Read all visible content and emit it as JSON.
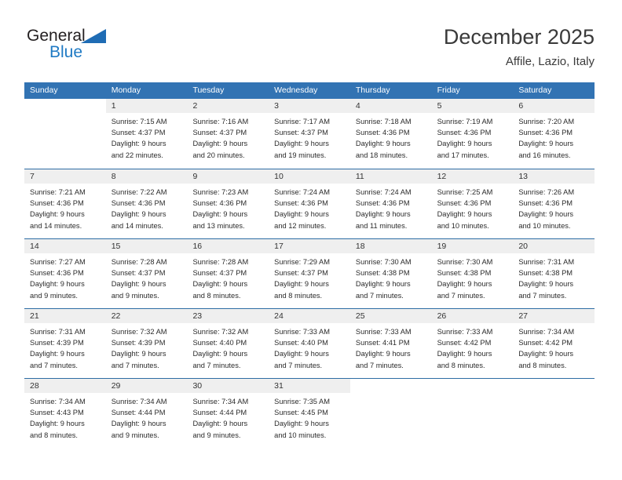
{
  "brand": {
    "name_part1": "General",
    "name_part2": "Blue",
    "triangle_color": "#1f6cb4",
    "blue_color": "#1f7ac4"
  },
  "header": {
    "title": "December 2025",
    "subtitle": "Affile, Lazio, Italy"
  },
  "theme": {
    "header_bg": "#3273b3",
    "row_rule": "#2e6da4",
    "num_band_bg": "#efefef"
  },
  "weekdays": [
    "Sunday",
    "Monday",
    "Tuesday",
    "Wednesday",
    "Thursday",
    "Friday",
    "Saturday"
  ],
  "weeks": [
    [
      {
        "day": "",
        "sunrise": "",
        "sunset": "",
        "daylight1": "",
        "daylight2": ""
      },
      {
        "day": "1",
        "sunrise": "Sunrise: 7:15 AM",
        "sunset": "Sunset: 4:37 PM",
        "daylight1": "Daylight: 9 hours",
        "daylight2": "and 22 minutes."
      },
      {
        "day": "2",
        "sunrise": "Sunrise: 7:16 AM",
        "sunset": "Sunset: 4:37 PM",
        "daylight1": "Daylight: 9 hours",
        "daylight2": "and 20 minutes."
      },
      {
        "day": "3",
        "sunrise": "Sunrise: 7:17 AM",
        "sunset": "Sunset: 4:37 PM",
        "daylight1": "Daylight: 9 hours",
        "daylight2": "and 19 minutes."
      },
      {
        "day": "4",
        "sunrise": "Sunrise: 7:18 AM",
        "sunset": "Sunset: 4:36 PM",
        "daylight1": "Daylight: 9 hours",
        "daylight2": "and 18 minutes."
      },
      {
        "day": "5",
        "sunrise": "Sunrise: 7:19 AM",
        "sunset": "Sunset: 4:36 PM",
        "daylight1": "Daylight: 9 hours",
        "daylight2": "and 17 minutes."
      },
      {
        "day": "6",
        "sunrise": "Sunrise: 7:20 AM",
        "sunset": "Sunset: 4:36 PM",
        "daylight1": "Daylight: 9 hours",
        "daylight2": "and 16 minutes."
      }
    ],
    [
      {
        "day": "7",
        "sunrise": "Sunrise: 7:21 AM",
        "sunset": "Sunset: 4:36 PM",
        "daylight1": "Daylight: 9 hours",
        "daylight2": "and 14 minutes."
      },
      {
        "day": "8",
        "sunrise": "Sunrise: 7:22 AM",
        "sunset": "Sunset: 4:36 PM",
        "daylight1": "Daylight: 9 hours",
        "daylight2": "and 14 minutes."
      },
      {
        "day": "9",
        "sunrise": "Sunrise: 7:23 AM",
        "sunset": "Sunset: 4:36 PM",
        "daylight1": "Daylight: 9 hours",
        "daylight2": "and 13 minutes."
      },
      {
        "day": "10",
        "sunrise": "Sunrise: 7:24 AM",
        "sunset": "Sunset: 4:36 PM",
        "daylight1": "Daylight: 9 hours",
        "daylight2": "and 12 minutes."
      },
      {
        "day": "11",
        "sunrise": "Sunrise: 7:24 AM",
        "sunset": "Sunset: 4:36 PM",
        "daylight1": "Daylight: 9 hours",
        "daylight2": "and 11 minutes."
      },
      {
        "day": "12",
        "sunrise": "Sunrise: 7:25 AM",
        "sunset": "Sunset: 4:36 PM",
        "daylight1": "Daylight: 9 hours",
        "daylight2": "and 10 minutes."
      },
      {
        "day": "13",
        "sunrise": "Sunrise: 7:26 AM",
        "sunset": "Sunset: 4:36 PM",
        "daylight1": "Daylight: 9 hours",
        "daylight2": "and 10 minutes."
      }
    ],
    [
      {
        "day": "14",
        "sunrise": "Sunrise: 7:27 AM",
        "sunset": "Sunset: 4:36 PM",
        "daylight1": "Daylight: 9 hours",
        "daylight2": "and 9 minutes."
      },
      {
        "day": "15",
        "sunrise": "Sunrise: 7:28 AM",
        "sunset": "Sunset: 4:37 PM",
        "daylight1": "Daylight: 9 hours",
        "daylight2": "and 9 minutes."
      },
      {
        "day": "16",
        "sunrise": "Sunrise: 7:28 AM",
        "sunset": "Sunset: 4:37 PM",
        "daylight1": "Daylight: 9 hours",
        "daylight2": "and 8 minutes."
      },
      {
        "day": "17",
        "sunrise": "Sunrise: 7:29 AM",
        "sunset": "Sunset: 4:37 PM",
        "daylight1": "Daylight: 9 hours",
        "daylight2": "and 8 minutes."
      },
      {
        "day": "18",
        "sunrise": "Sunrise: 7:30 AM",
        "sunset": "Sunset: 4:38 PM",
        "daylight1": "Daylight: 9 hours",
        "daylight2": "and 7 minutes."
      },
      {
        "day": "19",
        "sunrise": "Sunrise: 7:30 AM",
        "sunset": "Sunset: 4:38 PM",
        "daylight1": "Daylight: 9 hours",
        "daylight2": "and 7 minutes."
      },
      {
        "day": "20",
        "sunrise": "Sunrise: 7:31 AM",
        "sunset": "Sunset: 4:38 PM",
        "daylight1": "Daylight: 9 hours",
        "daylight2": "and 7 minutes."
      }
    ],
    [
      {
        "day": "21",
        "sunrise": "Sunrise: 7:31 AM",
        "sunset": "Sunset: 4:39 PM",
        "daylight1": "Daylight: 9 hours",
        "daylight2": "and 7 minutes."
      },
      {
        "day": "22",
        "sunrise": "Sunrise: 7:32 AM",
        "sunset": "Sunset: 4:39 PM",
        "daylight1": "Daylight: 9 hours",
        "daylight2": "and 7 minutes."
      },
      {
        "day": "23",
        "sunrise": "Sunrise: 7:32 AM",
        "sunset": "Sunset: 4:40 PM",
        "daylight1": "Daylight: 9 hours",
        "daylight2": "and 7 minutes."
      },
      {
        "day": "24",
        "sunrise": "Sunrise: 7:33 AM",
        "sunset": "Sunset: 4:40 PM",
        "daylight1": "Daylight: 9 hours",
        "daylight2": "and 7 minutes."
      },
      {
        "day": "25",
        "sunrise": "Sunrise: 7:33 AM",
        "sunset": "Sunset: 4:41 PM",
        "daylight1": "Daylight: 9 hours",
        "daylight2": "and 7 minutes."
      },
      {
        "day": "26",
        "sunrise": "Sunrise: 7:33 AM",
        "sunset": "Sunset: 4:42 PM",
        "daylight1": "Daylight: 9 hours",
        "daylight2": "and 8 minutes."
      },
      {
        "day": "27",
        "sunrise": "Sunrise: 7:34 AM",
        "sunset": "Sunset: 4:42 PM",
        "daylight1": "Daylight: 9 hours",
        "daylight2": "and 8 minutes."
      }
    ],
    [
      {
        "day": "28",
        "sunrise": "Sunrise: 7:34 AM",
        "sunset": "Sunset: 4:43 PM",
        "daylight1": "Daylight: 9 hours",
        "daylight2": "and 8 minutes."
      },
      {
        "day": "29",
        "sunrise": "Sunrise: 7:34 AM",
        "sunset": "Sunset: 4:44 PM",
        "daylight1": "Daylight: 9 hours",
        "daylight2": "and 9 minutes."
      },
      {
        "day": "30",
        "sunrise": "Sunrise: 7:34 AM",
        "sunset": "Sunset: 4:44 PM",
        "daylight1": "Daylight: 9 hours",
        "daylight2": "and 9 minutes."
      },
      {
        "day": "31",
        "sunrise": "Sunrise: 7:35 AM",
        "sunset": "Sunset: 4:45 PM",
        "daylight1": "Daylight: 9 hours",
        "daylight2": "and 10 minutes."
      },
      {
        "day": "",
        "sunrise": "",
        "sunset": "",
        "daylight1": "",
        "daylight2": ""
      },
      {
        "day": "",
        "sunrise": "",
        "sunset": "",
        "daylight1": "",
        "daylight2": ""
      },
      {
        "day": "",
        "sunrise": "",
        "sunset": "",
        "daylight1": "",
        "daylight2": ""
      }
    ]
  ]
}
